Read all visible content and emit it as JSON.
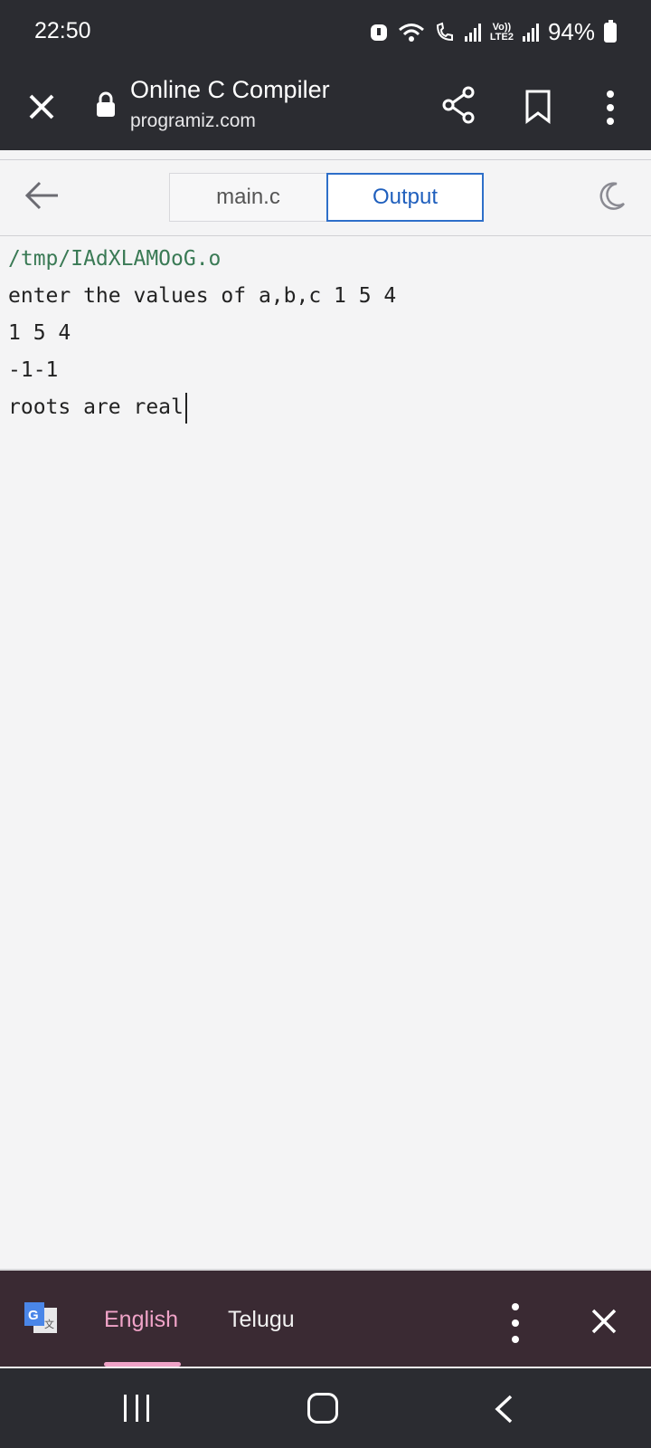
{
  "status_bar": {
    "time": "22:50",
    "battery": "94%",
    "volte": "Vo))",
    "lte": "LTE2",
    "icons": [
      "alarm-icon",
      "wifi-icon",
      "wifi-calling-icon",
      "signal-icon",
      "volte-icon",
      "signal-icon",
      "battery-icon"
    ]
  },
  "browser": {
    "title": "Online C Compiler",
    "url": "programiz.com",
    "icons": [
      "close-icon",
      "lock-icon",
      "share-icon",
      "bookmark-icon",
      "more-vert-icon"
    ]
  },
  "app": {
    "tabs": [
      {
        "label": "main.c",
        "active": false
      },
      {
        "label": "Output",
        "active": true
      }
    ],
    "accent_color": "#2e6fc9"
  },
  "console": {
    "lines": [
      "/tmp/IAdXLAMOoG.o",
      "enter the values of a,b,c 1 5 4",
      "1 5 4",
      "-1-1",
      "roots are real"
    ]
  },
  "translate_bar": {
    "languages": [
      "English",
      "Telugu"
    ],
    "selected": "English",
    "selected_color": "#f0a3c8"
  },
  "nav_bar": {
    "icons": [
      "recents-icon",
      "home-icon",
      "back-icon"
    ]
  }
}
